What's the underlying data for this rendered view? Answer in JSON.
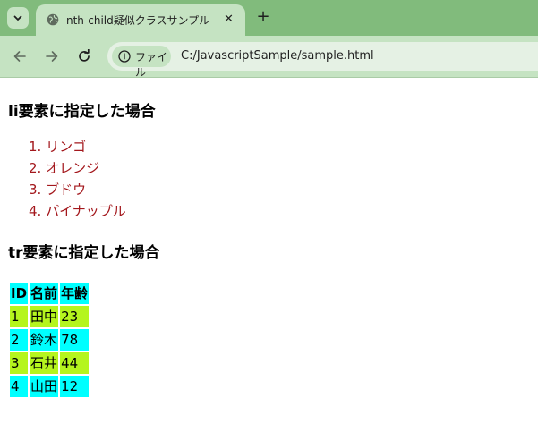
{
  "browser": {
    "tab_title": "nth-child疑似クラスサンプル",
    "tab_close": "✕",
    "new_tab": "+",
    "site_chip_label": "ファイル",
    "url": "C:/JavascriptSample/sample.html"
  },
  "page": {
    "heading_li": "li要素に指定した場合",
    "list_items": [
      {
        "number": "1.",
        "label": "リンゴ"
      },
      {
        "number": "2.",
        "label": "オレンジ"
      },
      {
        "number": "3.",
        "label": "ブドウ"
      },
      {
        "number": "4.",
        "label": "パイナップル"
      }
    ],
    "heading_tr": "tr要素に指定した場合",
    "table": {
      "headers": [
        "ID",
        "名前",
        "年齢"
      ],
      "rows": [
        [
          "1",
          "田中",
          "23"
        ],
        [
          "2",
          "鈴木",
          "78"
        ],
        [
          "3",
          "石井",
          "44"
        ],
        [
          "4",
          "山田",
          "12"
        ]
      ]
    }
  },
  "colors": {
    "tab_strip": "#81bb7c",
    "toolbar": "#c5e3c2",
    "list_text": "#a3171c",
    "header_cell": "#00ffff",
    "odd_row": "#b5f51e",
    "even_row": "#00ffff"
  },
  "icons": {
    "tab_menu": "chevron-down-icon",
    "favicon": "globe-icon",
    "back": "arrow-left-icon",
    "forward": "arrow-right-icon",
    "reload": "reload-icon",
    "info": "info-icon"
  }
}
